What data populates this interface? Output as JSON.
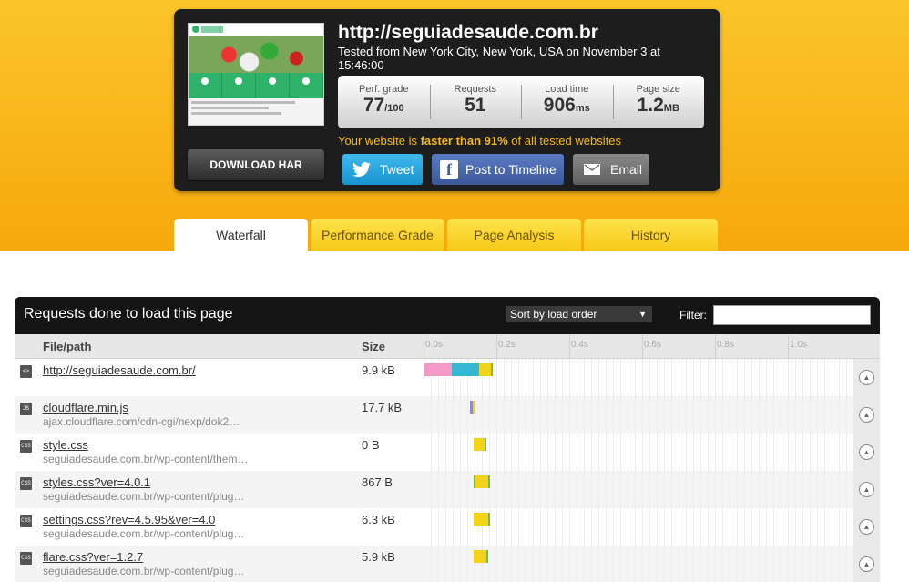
{
  "summary": {
    "url": "http://seguiadesaude.com.br",
    "tested_from": "Tested from New York City, New York, USA on November 3 at 15:46:00",
    "stats": [
      {
        "label": "Perf. grade",
        "value": "77",
        "unit": "/100"
      },
      {
        "label": "Requests",
        "value": "51",
        "unit": ""
      },
      {
        "label": "Load time",
        "value": "906",
        "unit": "ms"
      },
      {
        "label": "Page size",
        "value": "1.2",
        "unit": "MB"
      }
    ],
    "faster_prefix": "Your website is ",
    "faster_bold": "faster than 91%",
    "faster_suffix": " of all tested websites",
    "download_har": "DOWNLOAD HAR",
    "tweet": "Tweet",
    "post_to_timeline": "Post to Timeline",
    "email": "Email"
  },
  "tabs": [
    {
      "label": "Waterfall",
      "active": true
    },
    {
      "label": "Performance Grade",
      "active": false
    },
    {
      "label": "Page Analysis",
      "active": false
    },
    {
      "label": "History",
      "active": false
    }
  ],
  "requests_panel": {
    "title": "Requests done to load this page",
    "sort_selected": "Sort by load order",
    "filter_label": "Filter:",
    "filter_value": "",
    "col_file": "File/path",
    "col_size": "Size",
    "ticks": [
      "0.0s",
      "0.2s",
      "0.4s",
      "0.6s",
      "0.8s",
      "1.0s"
    ],
    "rows": [
      {
        "type": "<>",
        "name": "http://seguiadesaude.com.br/",
        "path": "",
        "size": "9.9 kB",
        "bar": [
          {
            "start": 0.0,
            "end": 0.075,
            "color": "#f59ac6"
          },
          {
            "start": 0.075,
            "end": 0.15,
            "color": "#35b7d3"
          },
          {
            "start": 0.15,
            "end": 0.183,
            "color": "#f3d31a"
          },
          {
            "start": 0.183,
            "end": 0.188,
            "color": "#79b94a"
          }
        ]
      },
      {
        "type": "JS",
        "name": "cloudflare.min.js",
        "path": "ajax.cloudflare.com/cdn-cgi/nexp/dok2…",
        "size": "17.7 kB",
        "bar": [
          {
            "start": 0.125,
            "end": 0.132,
            "color": "#8c8ccc"
          },
          {
            "start": 0.132,
            "end": 0.14,
            "color": "#f3d31a"
          }
        ]
      },
      {
        "type": "CSS",
        "name": "style.css",
        "path": "seguiadesaude.com.br/wp-content/them…",
        "size": "0 B",
        "bar": [
          {
            "start": 0.135,
            "end": 0.165,
            "color": "#f3d31a"
          },
          {
            "start": 0.165,
            "end": 0.17,
            "color": "#79b94a"
          }
        ]
      },
      {
        "type": "CSS",
        "name": "styles.css?ver=4.0.1",
        "path": "seguiadesaude.com.br/wp-content/plug…",
        "size": "867 B",
        "bar": [
          {
            "start": 0.135,
            "end": 0.14,
            "color": "#79b94a"
          },
          {
            "start": 0.14,
            "end": 0.175,
            "color": "#f3d31a"
          },
          {
            "start": 0.175,
            "end": 0.18,
            "color": "#79b94a"
          }
        ]
      },
      {
        "type": "CSS",
        "name": "settings.css?rev=4.5.95&ver=4.0",
        "path": "seguiadesaude.com.br/wp-content/plug…",
        "size": "6.3 kB",
        "bar": [
          {
            "start": 0.135,
            "end": 0.175,
            "color": "#f3d31a"
          },
          {
            "start": 0.175,
            "end": 0.178,
            "color": "#79b94a"
          }
        ]
      },
      {
        "type": "CSS",
        "name": "flare.css?ver=1.2.7",
        "path": "seguiadesaude.com.br/wp-content/plug…",
        "size": "5.9 kB",
        "bar": [
          {
            "start": 0.135,
            "end": 0.17,
            "color": "#f3d31a"
          },
          {
            "start": 0.17,
            "end": 0.175,
            "color": "#79b94a"
          }
        ]
      }
    ]
  }
}
